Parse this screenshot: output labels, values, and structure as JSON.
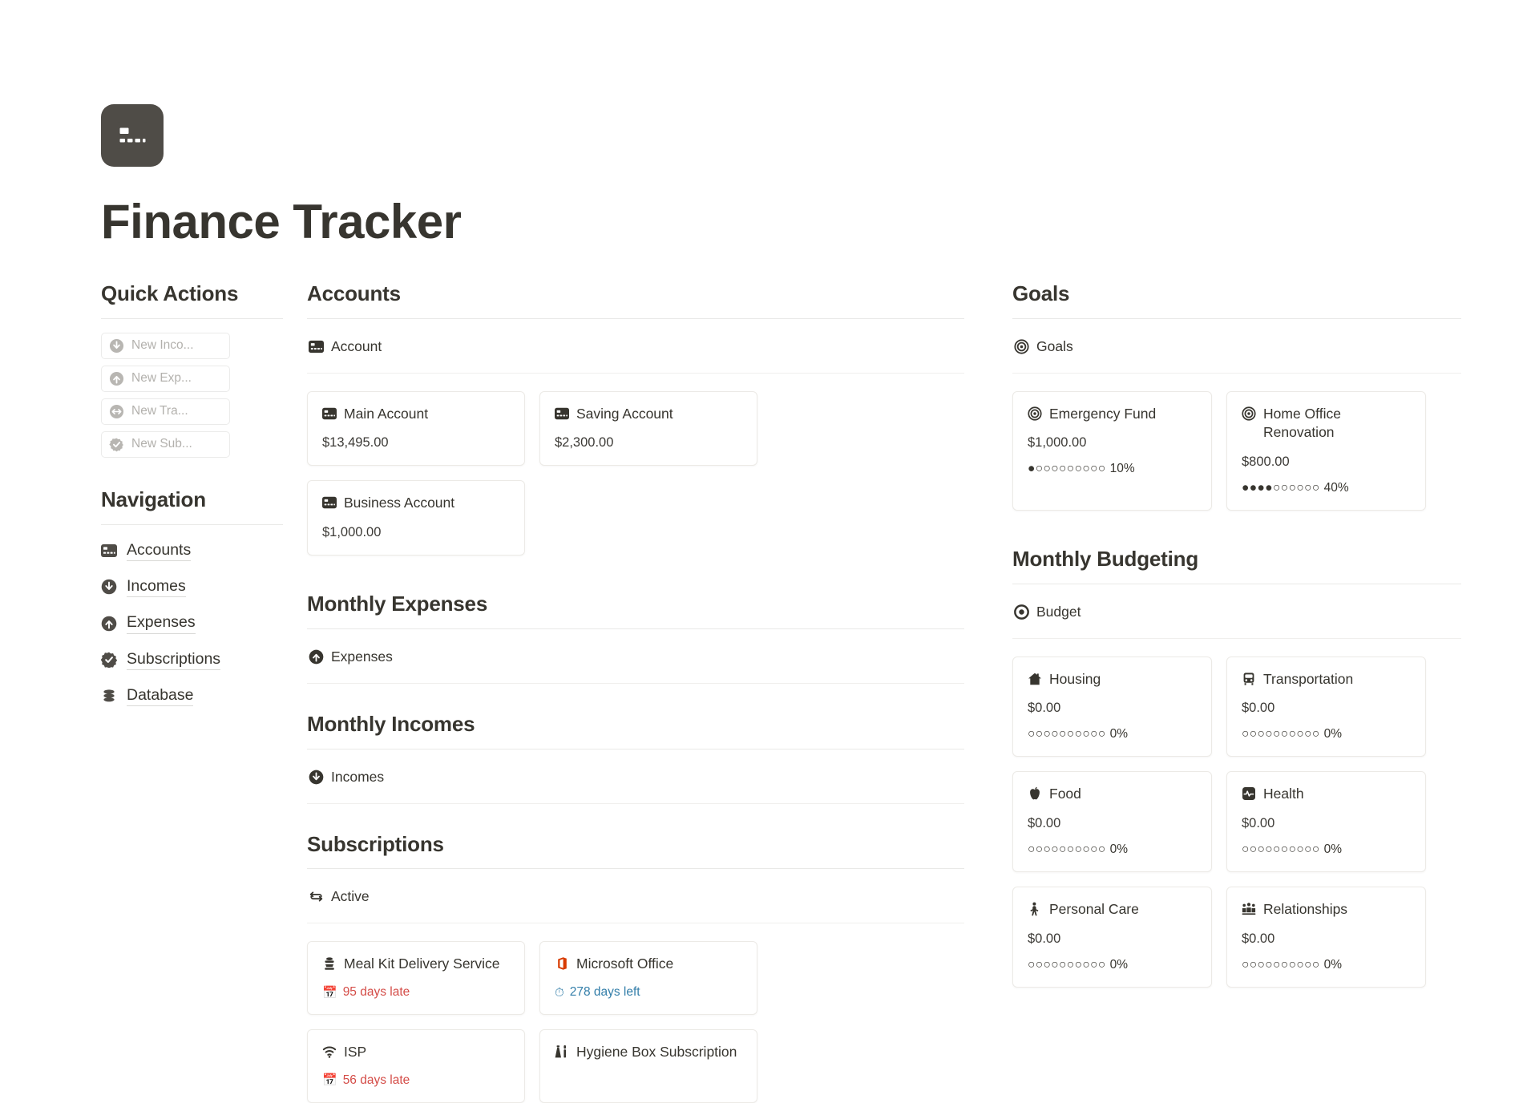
{
  "page": {
    "title": "Finance Tracker",
    "icon": "credit-card-icon"
  },
  "sidebar": {
    "quick_actions": {
      "heading": "Quick Actions",
      "buttons": [
        {
          "label": "New Inco...",
          "icon": "arrow-down-circle-icon"
        },
        {
          "label": "New Exp...",
          "icon": "arrow-up-circle-icon"
        },
        {
          "label": "New Tra...",
          "icon": "arrows-left-right-circle-icon"
        },
        {
          "label": "New Sub...",
          "icon": "verified-check-icon"
        }
      ]
    },
    "navigation": {
      "heading": "Navigation",
      "items": [
        {
          "label": "Accounts",
          "icon": "credit-card-icon"
        },
        {
          "label": "Incomes",
          "icon": "arrow-down-circle-icon"
        },
        {
          "label": "Expenses",
          "icon": "arrow-up-circle-icon"
        },
        {
          "label": "Subscriptions",
          "icon": "verified-check-icon"
        },
        {
          "label": "Database",
          "icon": "database-icon"
        }
      ]
    }
  },
  "main": {
    "accounts": {
      "heading": "Accounts",
      "view": {
        "label": "Account",
        "icon": "credit-card-icon"
      },
      "cards": [
        {
          "title": "Main Account",
          "amount": "$13,495.00",
          "icon": "credit-card-icon"
        },
        {
          "title": "Saving Account",
          "amount": "$2,300.00",
          "icon": "credit-card-icon"
        },
        {
          "title": "Business Account",
          "amount": "$1,000.00",
          "icon": "credit-card-icon"
        }
      ]
    },
    "monthly_expenses": {
      "heading": "Monthly Expenses",
      "view": {
        "label": "Expenses",
        "icon": "arrow-up-circle-icon"
      }
    },
    "monthly_incomes": {
      "heading": "Monthly Incomes",
      "view": {
        "label": "Incomes",
        "icon": "arrow-down-circle-icon"
      }
    },
    "subscriptions": {
      "heading": "Subscriptions",
      "view": {
        "label": "Active",
        "icon": "repeat-icon"
      },
      "cards": [
        {
          "title": "Meal Kit Delivery Service",
          "icon": "meal-kit-icon",
          "badge": "95 days late",
          "badge_type": "late",
          "badge_icon": "red-calendar-emoji"
        },
        {
          "title": "Microsoft Office",
          "icon": "microsoft-office-icon",
          "badge": "278 days left",
          "badge_type": "left",
          "badge_icon": "stopwatch-emoji"
        },
        {
          "title": "ISP",
          "icon": "wifi-icon",
          "badge": "56 days late",
          "badge_type": "late",
          "badge_icon": "red-calendar-emoji"
        },
        {
          "title": "Hygiene Box Subscription",
          "icon": "soap-dispenser-icon",
          "badge": "",
          "badge_type": "none",
          "badge_icon": ""
        }
      ]
    }
  },
  "right": {
    "goals": {
      "heading": "Goals",
      "view": {
        "label": "Goals",
        "icon": "target-icon"
      },
      "cards": [
        {
          "title": "Emergency Fund",
          "amount": "$1,000.00",
          "icon": "target-icon",
          "filled": 1,
          "total": 10,
          "percent": "10%"
        },
        {
          "title": "Home Office Renovation",
          "amount": "$800.00",
          "icon": "target-icon",
          "filled": 4,
          "total": 10,
          "percent": "40%"
        }
      ]
    },
    "budgeting": {
      "heading": "Monthly Budgeting",
      "view": {
        "label": "Budget",
        "icon": "record-circle-icon"
      },
      "cards": [
        {
          "title": "Housing",
          "amount": "$0.00",
          "icon": "house-icon",
          "filled": 0,
          "total": 10,
          "percent": "0%"
        },
        {
          "title": "Transportation",
          "amount": "$0.00",
          "icon": "bus-icon",
          "filled": 0,
          "total": 10,
          "percent": "0%"
        },
        {
          "title": "Food",
          "amount": "$0.00",
          "icon": "apple-icon",
          "filled": 0,
          "total": 10,
          "percent": "0%"
        },
        {
          "title": "Health",
          "amount": "$0.00",
          "icon": "heartbeat-icon",
          "filled": 0,
          "total": 10,
          "percent": "0%"
        },
        {
          "title": "Personal Care",
          "amount": "$0.00",
          "icon": "person-icon",
          "filled": 0,
          "total": 10,
          "percent": "0%"
        },
        {
          "title": "Relationships",
          "amount": "$0.00",
          "icon": "people-group-icon",
          "filled": 0,
          "total": 10,
          "percent": "0%"
        }
      ]
    }
  },
  "colors": {
    "text": "#37352f",
    "muted": "#b3b1ad",
    "rule": "#e9e9e7",
    "late": "#d44c47",
    "left": "#337ea9",
    "icon_bg": "#4f4c47",
    "office_red": "#d83b01"
  }
}
